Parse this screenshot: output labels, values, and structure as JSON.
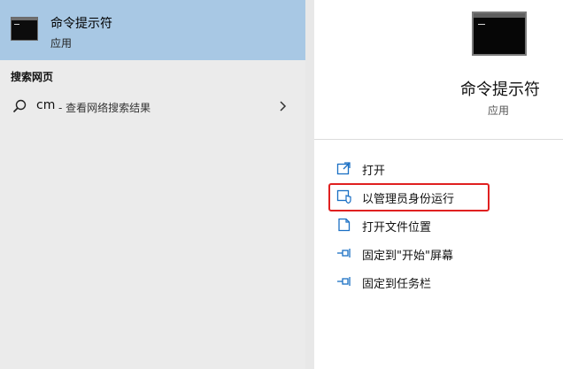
{
  "best_match": {
    "title": "命令提示符",
    "subtitle": "应用",
    "icon": "cmd-icon"
  },
  "section": {
    "label": "搜索网页"
  },
  "web_search": {
    "query": "cm",
    "suffix": "- 查看网络搜索结果",
    "icon": "search-icon",
    "chevron": "chevron-right-icon"
  },
  "details": {
    "title": "命令提示符",
    "subtitle": "应用",
    "icon": "cmd-icon"
  },
  "actions": [
    {
      "label": "打开",
      "icon": "open-icon"
    },
    {
      "label": "以管理员身份运行",
      "icon": "shield-icon"
    },
    {
      "label": "打开文件位置",
      "icon": "file-location-icon"
    },
    {
      "label": "固定到\"开始\"屏幕",
      "icon": "pin-icon"
    },
    {
      "label": "固定到任务栏",
      "icon": "pin-icon"
    }
  ],
  "colors": {
    "selection": "#a8c8e4",
    "accent": "#1a6fc4",
    "highlight_box": "#e02020"
  }
}
